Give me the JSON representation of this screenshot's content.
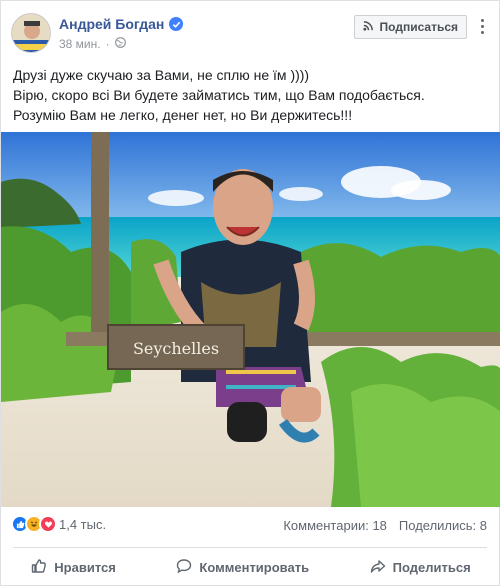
{
  "post": {
    "author": "Андрей Богдан",
    "time": "38 мин.",
    "subscribe_label": "Подписаться",
    "text_lines": [
      "Друзі дуже скучаю за Вами, не сплю не їм ))))",
      "Вірю, скоро всі Ви будете займатись тим, що Вам подобається.",
      "Розумію Вам не легко, денег нет, но Ви держитесь!!!"
    ],
    "photo_sign": "Seychelles"
  },
  "reactions": {
    "icons": [
      "like-icon",
      "haha-icon",
      "love-icon"
    ],
    "count": "1,4 тыс.",
    "comments": "Комментарии: 18",
    "shares": "Поделились: 8"
  },
  "actions": {
    "like": "Нравится",
    "comment": "Комментировать",
    "share": "Поделиться"
  },
  "colors": {
    "author_link": "#385898",
    "like_blue": "#1877f2",
    "love_red": "#f33e58",
    "haha_yellow": "#f7b125"
  }
}
